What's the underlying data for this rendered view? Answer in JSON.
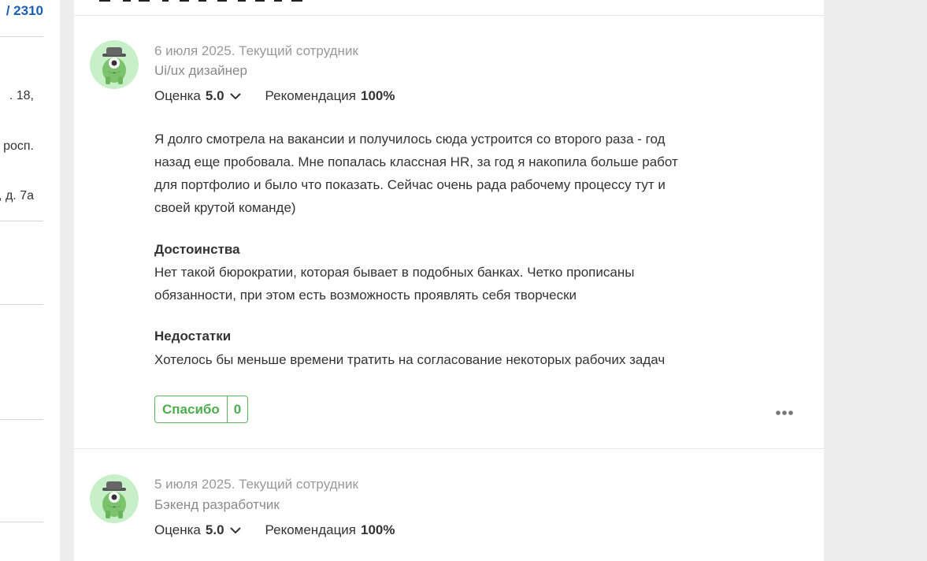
{
  "left_sidebar": {
    "link_fragment": "/ 2310",
    "text_fragments": [
      ". 18,",
      "росп.",
      ", д. 7а"
    ]
  },
  "reviews": [
    {
      "date_status": "6 июля 2025. Текущий сотрудник",
      "position": "Ui/ux дизайнер",
      "rating_label": "Оценка",
      "rating_value": "5.0",
      "recommend_label": "Рекомендация",
      "recommend_value": "100%",
      "text_lines": [
        "Я долго смотрела на вакансии и получилось сюда устроится со второго раза - год",
        "назад еще пробовала. Мне попалась классная HR, за год я накопила больше работ",
        "для портфолио и было что показать. Сейчас очень рада рабочему процессу тут и",
        "своей крутой команде)"
      ],
      "pros_title": "Достоинства",
      "pros_lines": [
        "Нет такой бюрократии, которая бывает в подобных банках. Четко прописаны",
        "обязанности, при этом есть возможность проявлять себя творчески"
      ],
      "cons_title": "Недостатки",
      "cons_lines": [
        "Хотелось бы меньше времени тратить на согласование некоторых рабочих задач"
      ],
      "thanks_label": "Спасибо",
      "thanks_count": "0"
    },
    {
      "date_status": "5 июля 2025. Текущий сотрудник",
      "position": "Бэкенд разработчик",
      "rating_label": "Оценка",
      "rating_value": "5.0",
      "recommend_label": "Рекомендация",
      "recommend_value": "100%"
    }
  ],
  "colors": {
    "link": "#1a5fb4",
    "thanks_green": "#4cae4c",
    "avatar_bg": "#c8f0c8",
    "avatar_body": "#7cc36d"
  },
  "icons": [
    "avatar-mascot-icon",
    "chevron-down-icon",
    "more-options-icon"
  ]
}
